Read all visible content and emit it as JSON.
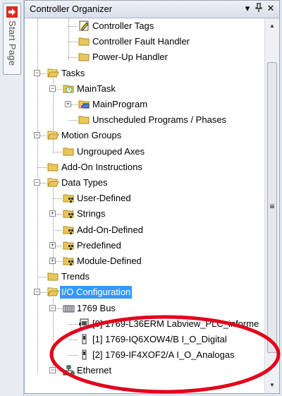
{
  "side_tab": {
    "label": "Start Page"
  },
  "panel": {
    "title": "Controller Organizer",
    "pin_symbol": "▾ 2 ✕"
  },
  "colors": {
    "folder": "#e8c75c",
    "selection": "#3399ff",
    "annotation": "#e3001b"
  },
  "tree": [
    {
      "label": "Controller Tags",
      "icon": "tags-icon"
    },
    {
      "label": "Controller Fault Handler",
      "icon": "folder-icon"
    },
    {
      "label": "Power-Up Handler",
      "icon": "folder-icon"
    },
    {
      "label": "Tasks",
      "icon": "open-folder-icon",
      "expander": "-"
    },
    {
      "label": "MainTask",
      "icon": "task-icon",
      "expander": "-"
    },
    {
      "label": "MainProgram",
      "icon": "program-icon",
      "expander": "+"
    },
    {
      "label": "Unscheduled Programs / Phases",
      "icon": "folder-icon"
    },
    {
      "label": "Motion Groups",
      "icon": "open-folder-icon",
      "expander": "-"
    },
    {
      "label": "Ungrouped Axes",
      "icon": "folder-icon"
    },
    {
      "label": "Add-On Instructions",
      "icon": "folder-icon"
    },
    {
      "label": "Data Types",
      "icon": "open-folder-icon",
      "expander": "-"
    },
    {
      "label": "User-Defined",
      "icon": "datatype-folder-icon"
    },
    {
      "label": "Strings",
      "icon": "datatype-folder-icon",
      "expander": "+"
    },
    {
      "label": "Add-On-Defined",
      "icon": "datatype-folder-icon"
    },
    {
      "label": "Predefined",
      "icon": "datatype-folder-icon",
      "expander": "+"
    },
    {
      "label": "Module-Defined",
      "icon": "datatype-folder-icon",
      "expander": "+"
    },
    {
      "label": "Trends",
      "icon": "folder-icon"
    },
    {
      "label": "I/O Configuration",
      "icon": "open-folder-icon",
      "expander": "-",
      "selected": true
    },
    {
      "label": "1769 Bus",
      "icon": "bus-icon",
      "expander": "-"
    },
    {
      "label": "[0] 1769-L36ERM Labview_PLC_informe",
      "icon": "controller-module-icon"
    },
    {
      "label": "[1] 1769-IQ6XOW4/B I_O_Digital",
      "icon": "io-module-icon"
    },
    {
      "label": "[2] 1769-IF4XOF2/A I_O_Analogas",
      "icon": "io-module-icon"
    },
    {
      "label": "Ethernet",
      "icon": "network-icon",
      "expander": "-"
    }
  ]
}
